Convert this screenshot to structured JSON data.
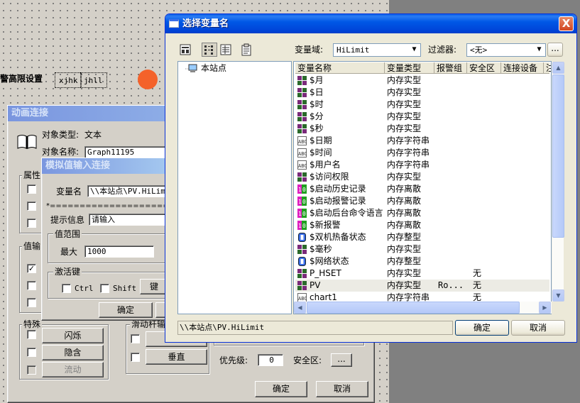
{
  "canvas": {
    "label_high_limit": "警高限设置",
    "label_obj1": "xjhk",
    "label_obj2": "jhll"
  },
  "anim_dialog": {
    "title": "动画连接",
    "obj_type_label": "对象类型:",
    "obj_type_value": "文本",
    "obj_name_label": "对象名称:",
    "obj_name_value": "Graph11195",
    "group_attr": "属性",
    "group_value": "值输",
    "group_special": "特殊",
    "blink_btn": "闪烁",
    "hide_btn": "隐含",
    "flow_btn": "流动",
    "vertical_btn": "垂直",
    "drag_group": "滑动杆输",
    "priority_label": "优先级:",
    "priority_value": "0",
    "secarea_label": "安全区:",
    "secarea_btn": "...",
    "ok": "确定",
    "cancel": "取消"
  },
  "analog_dialog": {
    "title": "模拟值输入连接",
    "var_label": "变量名",
    "var_value": "\\\\本站点\\PV.HiLimit",
    "separator": "*=========================",
    "prompt_label": "提示信息",
    "prompt_value": "请输入",
    "range_group": "值范围",
    "max_label": "最大",
    "max_value": "1000",
    "hotkey_group": "激活键",
    "ctrl_label": "Ctrl",
    "shift_label": "Shift",
    "key_btn": "键",
    "ok": "确定"
  },
  "select_dialog": {
    "title": "选择变量名",
    "close": "X",
    "domain_label": "变量域:",
    "domain_value": "HiLimit",
    "filter_label": "过滤器:",
    "filter_value": "<无>",
    "filter_btn": "...",
    "tree_root": "本站点",
    "columns": [
      "变量名称",
      "变量类型",
      "报警组",
      "安全区",
      "连接设备",
      "注"
    ],
    "rows": [
      {
        "icon": "grid",
        "name": "$月",
        "type": "内存实型",
        "alarm": "",
        "sec": ""
      },
      {
        "icon": "grid",
        "name": "$日",
        "type": "内存实型",
        "alarm": "",
        "sec": ""
      },
      {
        "icon": "grid",
        "name": "$时",
        "type": "内存实型",
        "alarm": "",
        "sec": ""
      },
      {
        "icon": "grid",
        "name": "$分",
        "type": "内存实型",
        "alarm": "",
        "sec": ""
      },
      {
        "icon": "grid",
        "name": "$秒",
        "type": "内存实型",
        "alarm": "",
        "sec": ""
      },
      {
        "icon": "abc",
        "name": "$日期",
        "type": "内存字符串",
        "alarm": "",
        "sec": ""
      },
      {
        "icon": "abc",
        "name": "$时间",
        "type": "内存字符串",
        "alarm": "",
        "sec": ""
      },
      {
        "icon": "abc",
        "name": "$用户名",
        "type": "内存字符串",
        "alarm": "",
        "sec": ""
      },
      {
        "icon": "grid",
        "name": "$访问权限",
        "type": "内存实型",
        "alarm": "",
        "sec": ""
      },
      {
        "icon": "bit",
        "name": "$启动历史记录",
        "type": "内存离散",
        "alarm": "",
        "sec": ""
      },
      {
        "icon": "bit",
        "name": "$启动报警记录",
        "type": "内存离散",
        "alarm": "",
        "sec": ""
      },
      {
        "icon": "bit",
        "name": "$启动后台命令语言",
        "type": "内存离散",
        "alarm": "",
        "sec": ""
      },
      {
        "icon": "bit",
        "name": "$新报警",
        "type": "内存离散",
        "alarm": "",
        "sec": ""
      },
      {
        "icon": "int",
        "name": "$双机热备状态",
        "type": "内存整型",
        "alarm": "",
        "sec": ""
      },
      {
        "icon": "grid",
        "name": "$毫秒",
        "type": "内存实型",
        "alarm": "",
        "sec": ""
      },
      {
        "icon": "int",
        "name": "$网络状态",
        "type": "内存整型",
        "alarm": "",
        "sec": ""
      },
      {
        "icon": "grid",
        "name": "P_HSET",
        "type": "内存实型",
        "alarm": "",
        "sec": "无"
      },
      {
        "icon": "grid",
        "name": "PV",
        "type": "内存实型",
        "alarm": "Ro...",
        "sec": "无"
      },
      {
        "icon": "abc",
        "name": "chart1",
        "type": "内存字符串",
        "alarm": "",
        "sec": "无"
      }
    ],
    "path_value": "\\\\本站点\\PV.HiLimit",
    "ok": "确定",
    "cancel": "取消"
  }
}
